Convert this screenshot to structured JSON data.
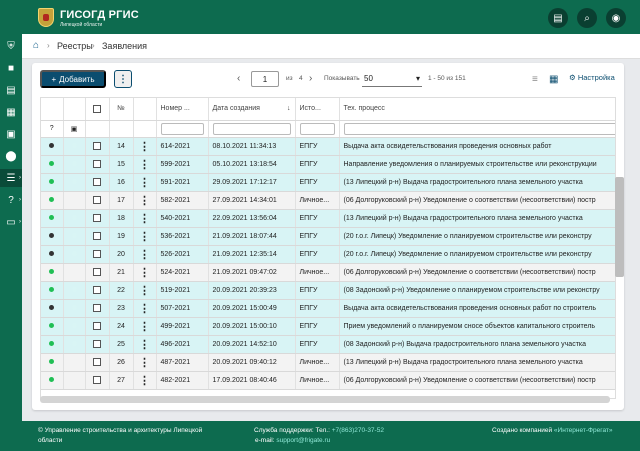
{
  "header": {
    "title": "ГИСОГД РГИС",
    "subtitle": "Липецкой области",
    "buttons": [
      {
        "name": "document-icon",
        "glyph": "▤"
      },
      {
        "name": "search-icon",
        "glyph": "⌕"
      },
      {
        "name": "account-icon",
        "glyph": "◉"
      }
    ]
  },
  "sidebar": {
    "items": [
      {
        "name": "sidebar-item-shield",
        "glyph": "⛨"
      },
      {
        "name": "sidebar-item-folder",
        "glyph": "■"
      },
      {
        "name": "sidebar-item-book",
        "glyph": "▤"
      },
      {
        "name": "sidebar-item-building",
        "glyph": "▦"
      },
      {
        "name": "sidebar-item-folder-person",
        "glyph": "▣"
      },
      {
        "name": "sidebar-item-map",
        "glyph": "⬤"
      },
      {
        "name": "sidebar-item-registers",
        "glyph": "☰",
        "active": true,
        "chevron": "›"
      },
      {
        "name": "sidebar-item-help",
        "glyph": "?",
        "chevron": "›"
      },
      {
        "name": "sidebar-item-monitor",
        "glyph": "▭",
        "chevron": "›"
      }
    ]
  },
  "breadcrumb": {
    "home": "⌂",
    "registers": "Реестры",
    "current": "Заявления",
    "separator": "›"
  },
  "toolbar": {
    "add_icon": "+",
    "add_label": "Добавить",
    "more_label": "⋮",
    "prev": "‹",
    "page": "1",
    "of": "из",
    "pages": "4",
    "next": "›",
    "show_label": "Показывать",
    "page_size": "50",
    "dropdown": "▾",
    "range": "1 - 50 из 151",
    "list_view_icon": "≡",
    "grid_view_icon": "▦",
    "settings_icon": "⚙",
    "settings_label": "Настройка"
  },
  "table": {
    "headers": {
      "no": "№",
      "number": "Номер ...",
      "date": "Дата создания",
      "date_sort": "↓",
      "source": "Исто...",
      "process": "Тех. процесс"
    },
    "filter_icons": {
      "help": "?",
      "person": "▣"
    },
    "rows": [
      {
        "status": "#333333",
        "mark": "#d9f5f5",
        "no": "14",
        "number": "614-2021",
        "date": "08.10.2021 11:34:13",
        "source": "ЕПГУ",
        "process": "Выдача акта освидетельствования проведения основных работ",
        "tone": "cyan"
      },
      {
        "status": "#20bf55",
        "mark": "#d9f5f5",
        "no": "15",
        "number": "599-2021",
        "date": "05.10.2021 13:18:54",
        "source": "ЕПГУ",
        "process": "Направление уведомления о планируемых строительстве или реконструкции",
        "tone": "cyan"
      },
      {
        "status": "#20bf55",
        "mark": "#d9f5f5",
        "no": "16",
        "number": "591-2021",
        "date": "29.09.2021 17:12:17",
        "source": "ЕПГУ",
        "process": "(13 Липецкий р-н) Выдача градостроительного плана земельного участка",
        "tone": "cyan"
      },
      {
        "status": "#20bf55",
        "mark": "#f3f3f3",
        "no": "17",
        "number": "582-2021",
        "date": "27.09.2021 14:34:01",
        "source": "Личное...",
        "process": "(06 Долгоруковский р-н) Уведомление о соответствии (несоответствии) постр",
        "tone": "white"
      },
      {
        "status": "#20bf55",
        "mark": "#d9f5f5",
        "no": "18",
        "number": "540-2021",
        "date": "22.09.2021 13:56:04",
        "source": "ЕПГУ",
        "process": "(13 Липецкий р-н) Выдача градостроительного плана земельного участка",
        "tone": "cyan"
      },
      {
        "status": "#333333",
        "mark": "#d9f5f5",
        "no": "19",
        "number": "536-2021",
        "date": "21.09.2021 18:07:44",
        "source": "ЕПГУ",
        "process": "(20 г.о.г. Липецк) Уведомление о планируемом строительстве или реконстру",
        "tone": "cyan"
      },
      {
        "status": "#333333",
        "mark": "#d9f5f5",
        "no": "20",
        "number": "526-2021",
        "date": "21.09.2021 12:35:14",
        "source": "ЕПГУ",
        "process": "(20 г.о.г. Липецк) Уведомление о планируемом строительстве или реконстру",
        "tone": "cyan"
      },
      {
        "status": "#20bf55",
        "mark": "#f3f3f3",
        "no": "21",
        "number": "524-2021",
        "date": "21.09.2021 09:47:02",
        "source": "Личное...",
        "process": "(06 Долгоруковский р-н) Уведомление о соответствии (несоответствии) постр",
        "tone": "white"
      },
      {
        "status": "#20bf55",
        "mark": "#d9f5f5",
        "no": "22",
        "number": "519-2021",
        "date": "20.09.2021 20:39:23",
        "source": "ЕПГУ",
        "process": "(08 Задонский р-н) Уведомление о планируемом строительстве или реконстру",
        "tone": "cyan"
      },
      {
        "status": "#333333",
        "mark": "#d9f5f5",
        "no": "23",
        "number": "507-2021",
        "date": "20.09.2021 15:00:49",
        "source": "ЕПГУ",
        "process": "Выдача акта освидетельствования проведения основных работ по строитель",
        "tone": "cyan"
      },
      {
        "status": "#20bf55",
        "mark": "#d9f5f5",
        "no": "24",
        "number": "499-2021",
        "date": "20.09.2021 15:00:10",
        "source": "ЕПГУ",
        "process": "Прием уведомлений о планируемом сносе объектов капитального строитель",
        "tone": "cyan"
      },
      {
        "status": "#20bf55",
        "mark": "#d9f5f5",
        "no": "25",
        "number": "496-2021",
        "date": "20.09.2021 14:52:10",
        "source": "ЕПГУ",
        "process": "(08 Задонский р-н) Выдача градостроительного плана земельного участка",
        "tone": "cyan"
      },
      {
        "status": "#20bf55",
        "mark": "#f3f3f3",
        "no": "26",
        "number": "487-2021",
        "date": "20.09.2021 09:40:12",
        "source": "Личное...",
        "process": "(13 Липецкий р-н) Выдача градостроительного плана земельного участка",
        "tone": "white"
      },
      {
        "status": "#20bf55",
        "mark": "#f3f3f3",
        "no": "27",
        "number": "482-2021",
        "date": "17.09.2021 08:40:46",
        "source": "Личное...",
        "process": "(06 Долгоруковский р-н) Уведомление о соответствии (несоответствии) постр",
        "tone": "white"
      }
    ]
  },
  "footer": {
    "copyright": "© Управление строительства и архитектуры Липецкой",
    "copyright_2": "области",
    "support_label": "Служба поддержки:",
    "phone_label": "Тел.:",
    "phone": "+7(863)270-37-52",
    "email_label": "e-mail:",
    "email": "support@frigate.ru",
    "created_label": "Создано компанией",
    "company": "«Интернет-Фрегат»"
  }
}
